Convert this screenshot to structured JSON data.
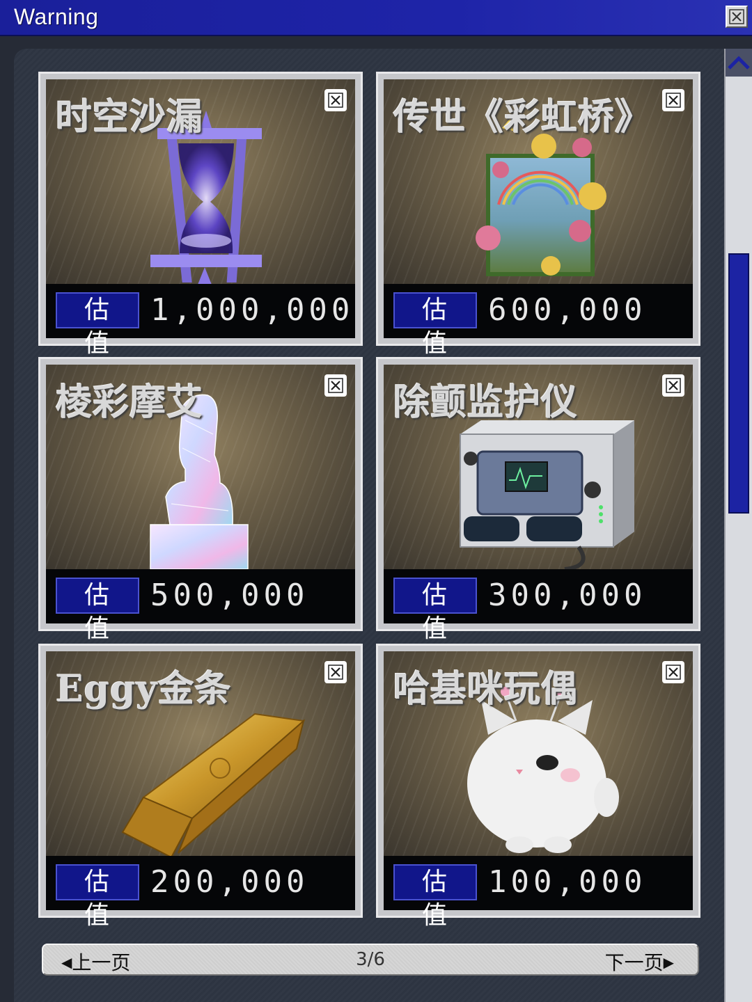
{
  "window": {
    "title": "Warning"
  },
  "items": [
    {
      "name": "时空沙漏",
      "value_label": "估值",
      "value": "1,000,000"
    },
    {
      "name": "传世《彩虹桥》",
      "value_label": "估值",
      "value": "600,000"
    },
    {
      "name": "棱彩摩艾",
      "value_label": "估值",
      "value": "500,000"
    },
    {
      "name": "除颤监护仪",
      "value_label": "估值",
      "value": "300,000"
    },
    {
      "name": "Eggy金条",
      "value_label": "估值",
      "value": "200,000"
    },
    {
      "name": "哈基咪玩偶",
      "value_label": "估值",
      "value": "100,000"
    }
  ],
  "pager": {
    "prev": "上一页",
    "page": "3/6",
    "next": "下一页"
  },
  "icons": {
    "close": "close-icon",
    "scroll_up": "chevron-up-icon",
    "prev": "triangle-left-icon",
    "next": "triangle-right-icon"
  },
  "colors": {
    "title_bar": "#1e24a8",
    "value_label_bg": "#11168a",
    "scroll_thumb": "#1c23a3"
  }
}
